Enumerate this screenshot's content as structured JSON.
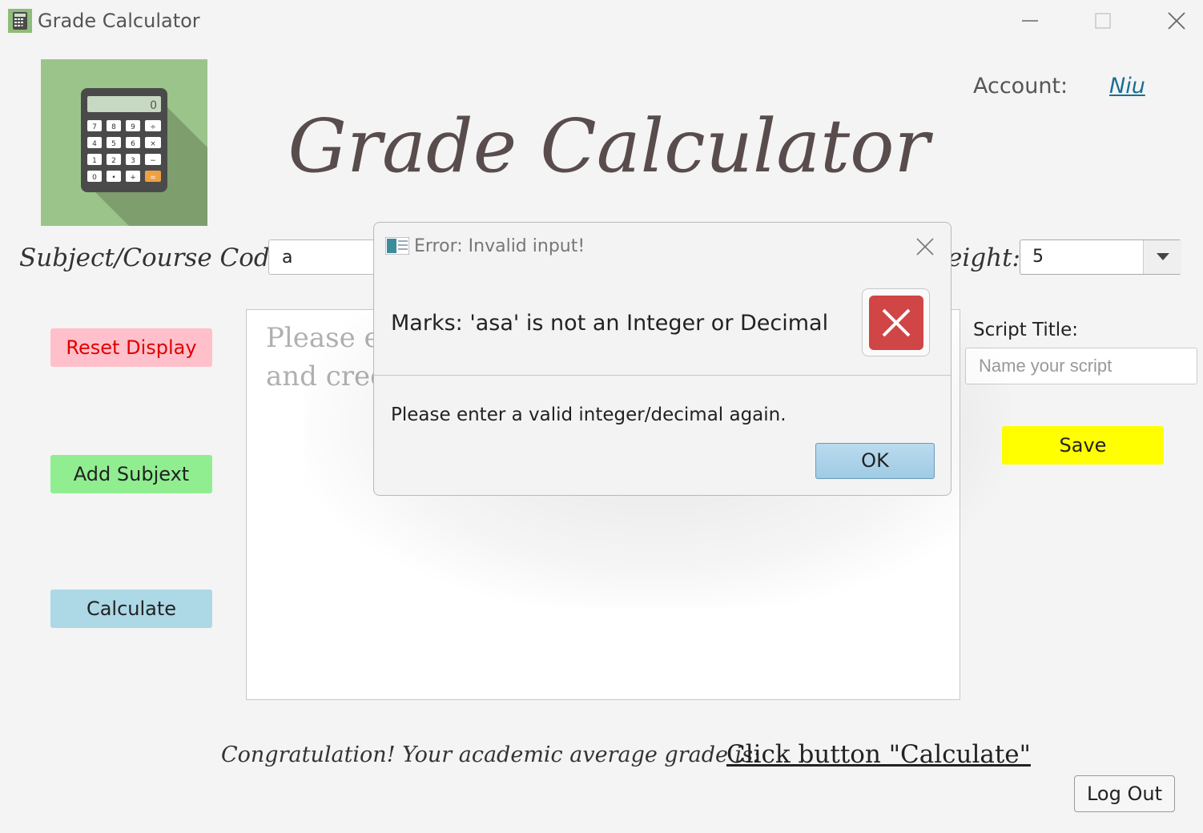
{
  "window": {
    "title": "Grade Calculator",
    "controls": {
      "minimize": "minimize",
      "maximize": "maximize",
      "close": "close"
    }
  },
  "header": {
    "title": "Grade Calculator",
    "account_label": "Account:",
    "account_name": "Niu"
  },
  "form": {
    "subject_label": "Subject/Course Code:",
    "subject_value": "a",
    "weight_label": "eight:",
    "weight_value": "5"
  },
  "buttons": {
    "reset": "Reset Display",
    "add": "Add Subjext",
    "calculate": "Calculate",
    "save": "Save",
    "logout": "Log Out"
  },
  "display": {
    "placeholder": "Please er\nand cred"
  },
  "script": {
    "label": "Script Title:",
    "placeholder": "Name your script"
  },
  "footer": {
    "congrats": "Congratulation! Your academic average grade is:",
    "result": "Click button \"Calculate\""
  },
  "dialog": {
    "title": "Error: Invalid input!",
    "header": "Marks: 'asa' is not an Integer or Decimal",
    "content": "Please enter a valid integer/decimal again.",
    "ok": "OK",
    "icon": "error-x-icon"
  },
  "colors": {
    "reset_bg": "#ffc0cb",
    "reset_text": "#e00000",
    "add_bg": "#90ee90",
    "calc_bg": "#add8e6",
    "save_bg": "#ffff00",
    "logo_bg": "#9bc48a",
    "title_color": "#594c4c",
    "link_color": "#1a6e96",
    "error_red": "#d04545"
  }
}
